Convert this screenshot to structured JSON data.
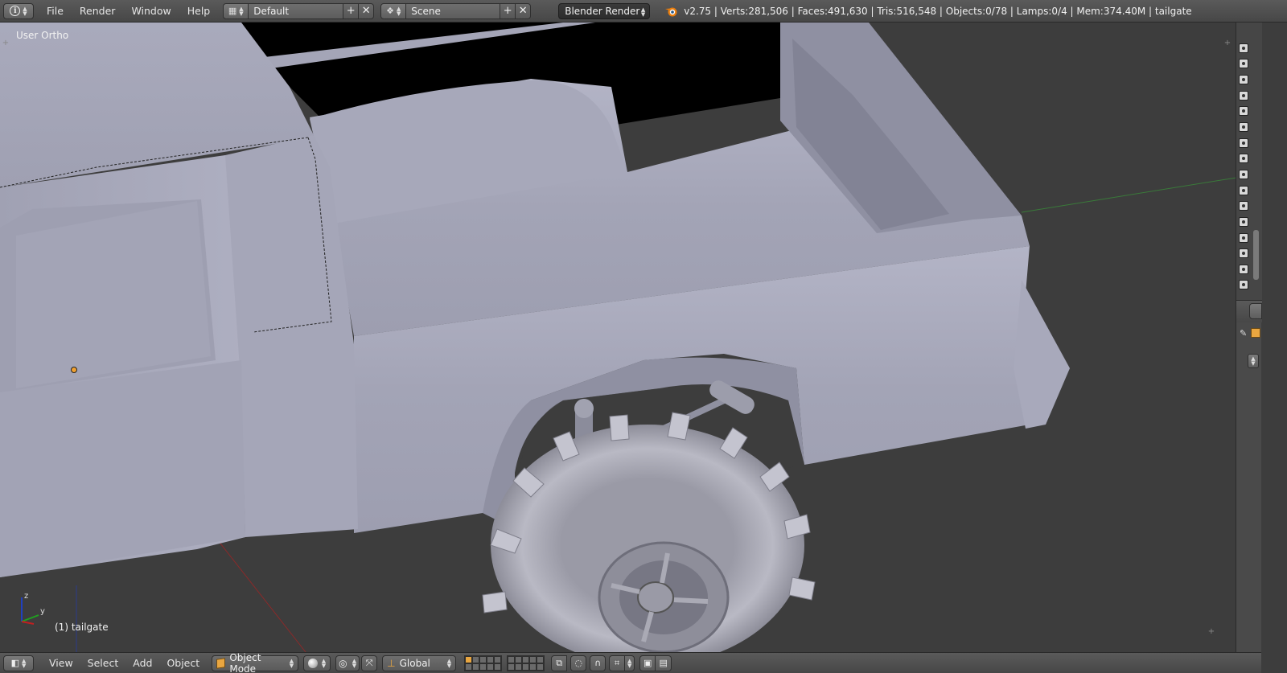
{
  "top_bar": {
    "menus": [
      "File",
      "Render",
      "Window",
      "Help"
    ],
    "screen_layout": "Default",
    "scene": "Scene",
    "render_engine": "Blender Render",
    "stats": "v2.75 | Verts:281,506 | Faces:491,630 | Tris:516,548 | Objects:0/78 | Lamps:0/4 | Mem:374.40M | tailgate"
  },
  "viewport": {
    "view_label": "User Ortho",
    "object_label": "(1) tailgate",
    "axis_labels": {
      "z": "z",
      "y": "y"
    }
  },
  "bottom_bar": {
    "menus": [
      "View",
      "Select",
      "Add",
      "Object"
    ],
    "mode": "Object Mode",
    "orientation": "Global"
  },
  "colors": {
    "header": "#4f4f4f",
    "viewport_bg": "#3d3d3d",
    "mesh": "#a6a7b9",
    "accent_orange": "#e9a640"
  }
}
